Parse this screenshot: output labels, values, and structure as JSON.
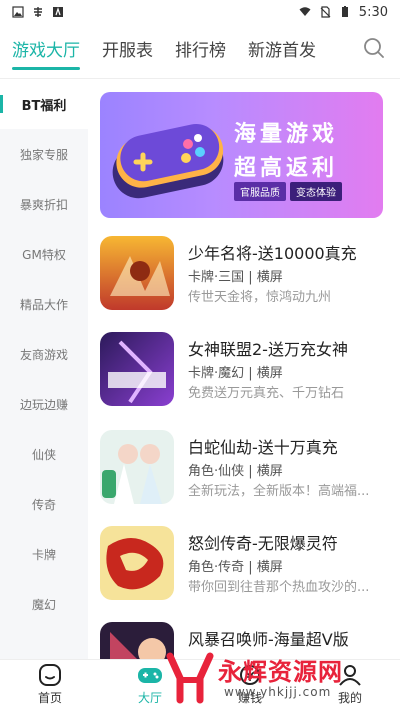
{
  "status_bar": {
    "time": "5:30"
  },
  "top_tabs": [
    {
      "label": "游戏大厅",
      "active": true
    },
    {
      "label": "开服表"
    },
    {
      "label": "排行榜"
    },
    {
      "label": "新游首发"
    }
  ],
  "sidebar": {
    "items": [
      {
        "label": "BT福利",
        "active": true
      },
      {
        "label": "独家专服"
      },
      {
        "label": "暴爽折扣"
      },
      {
        "label": "GM特权"
      },
      {
        "label": "精品大作"
      },
      {
        "label": "友商游戏"
      },
      {
        "label": "边玩边赚"
      },
      {
        "label": "仙侠"
      },
      {
        "label": "传奇"
      },
      {
        "label": "卡牌"
      },
      {
        "label": "魔幻"
      }
    ]
  },
  "banner": {
    "title": "海量游戏",
    "subtitle": "超高返利",
    "tags": [
      "官服品质",
      "变态体验"
    ]
  },
  "games": [
    {
      "name": "少年名将-送10000真充",
      "tags": "卡牌·三国 | 横屏",
      "desc": "传世天金将，惊鸿动九州"
    },
    {
      "name": "女神联盟2-送万充女神",
      "tags": "卡牌·魔幻 | 横屏",
      "desc": "免费送万元真充、千万钻石"
    },
    {
      "name": "白蛇仙劫-送十万真充",
      "tags": "角色·仙侠 | 横屏",
      "desc": "全新玩法，全新版本！高端福..."
    },
    {
      "name": "怒剑传奇-无限爆灵符",
      "tags": "角色·传奇 | 横屏",
      "desc": "带你回到往昔那个热血攻沙的..."
    },
    {
      "name": "风暴召唤师-海量超V版",
      "tags": "",
      "desc": ""
    }
  ],
  "bottom_nav": [
    {
      "label": "首页"
    },
    {
      "label": "大厅",
      "active": true
    },
    {
      "label": "赚钱"
    },
    {
      "label": "我的"
    }
  ],
  "watermark": {
    "title": "永辉资源网",
    "url": "www.yhkjjj.com"
  },
  "colors": {
    "accent": "#1bb5a7",
    "watermark_red": "#e8233b"
  }
}
